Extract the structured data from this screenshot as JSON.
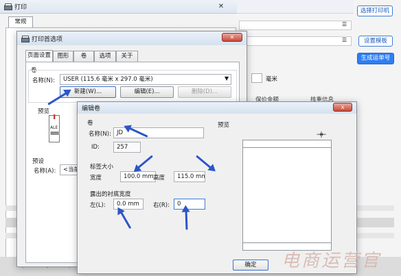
{
  "main_window": {
    "title": "打印",
    "tab": "常规",
    "buttons": {
      "select_printer": "选择打印机",
      "set_template": "设置模板",
      "generate_waybill": "生成运单号"
    },
    "partial_labels": {
      "mm": "毫米",
      "left_col": "保价金额",
      "right_col": "核重信息"
    }
  },
  "print_pref": {
    "title": "打印首选项",
    "tabs": [
      "页面设置",
      "图形",
      "卷",
      "选项",
      "关于"
    ],
    "paper_group": "卷",
    "name_label": "名称(N):",
    "name_value": "USER (115.6 毫米 x 297.0 毫米)",
    "new_button": "新建(W)...",
    "edit_button": "编辑(E)...",
    "delete_button": "删除(D)...",
    "preview_label": "预览",
    "preview_icon_text": "ALE",
    "preset_group": "预设",
    "preset_name_label": "名称(A):",
    "preset_name_value": "<当前"
  },
  "edit_roll": {
    "title": "编辑卷",
    "close_label": "x",
    "roll_group": "卷",
    "name_label": "名称(N):",
    "name_value": "JD",
    "id_label": "ID:",
    "id_value": "257",
    "label_size_group": "标签大小",
    "width_label": "宽度",
    "width_value": "100.0 mm",
    "height_label": "高度",
    "height_value": "115.0 mm",
    "liner_group": "露出的衬底宽度",
    "left_label": "左(L):",
    "left_value": "0.0 mm",
    "right_label": "右(R):",
    "right_value": "0",
    "preview_label": "预览",
    "ok_button": "确定"
  },
  "watermark": "电商运营官",
  "colors": {
    "arrow": "#2c55c9",
    "accent_blue": "#2f7ef2",
    "watermark": "#d6b8b0"
  }
}
